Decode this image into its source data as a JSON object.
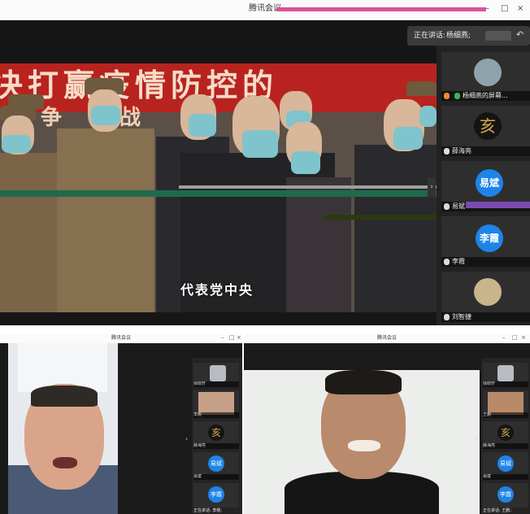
{
  "main_window": {
    "title": "腾讯会议",
    "controls": {
      "minimize": "–",
      "maximize": "□",
      "close": "×"
    },
    "speaking_label": "正在讲话:",
    "speaking_name": "杨细燕;",
    "back_icon": "back-arrow-icon",
    "shared_banner_top": "决打赢疫情防控的",
    "shared_banner_bottom": "争 体战",
    "shared_subtitle": "代表党中央",
    "participants": [
      {
        "name": "杨细燕的屏幕...",
        "avatar": "",
        "type": "image"
      },
      {
        "name": "薛海亮",
        "avatar": "亥",
        "type": "char"
      },
      {
        "name": "易斌",
        "avatar": "易斌",
        "type": "circle"
      },
      {
        "name": "李霞",
        "avatar": "李霞",
        "type": "circle"
      },
      {
        "name": "刘智捷",
        "avatar": "",
        "type": "image"
      }
    ]
  },
  "bottom_left_window": {
    "title": "腾讯会议",
    "speaking_label": "正在讲话: 李桃;",
    "participants": [
      {
        "name": "徐晓轩",
        "avatar": "",
        "type": "image"
      },
      {
        "name": "李桃",
        "avatar": "",
        "type": "image"
      },
      {
        "name": "薛海亮",
        "avatar": "亥",
        "type": "char"
      },
      {
        "name": "易斌",
        "avatar": "易斌",
        "type": "circle"
      },
      {
        "name": "",
        "avatar": "李霞",
        "type": "circle"
      }
    ]
  },
  "bottom_right_window": {
    "title": "腾讯会议",
    "speaking_label": "正在讲话: 王鹏;",
    "participants": [
      {
        "name": "徐晓轩",
        "avatar": "",
        "type": "image"
      },
      {
        "name": "王鹏",
        "avatar": "",
        "type": "image"
      },
      {
        "name": "薛海亮",
        "avatar": "亥",
        "type": "char"
      },
      {
        "name": "易斌",
        "avatar": "易斌",
        "type": "circle"
      },
      {
        "name": "",
        "avatar": "李霞",
        "type": "circle"
      }
    ]
  },
  "colors": {
    "accent_blue": "#1e84e8",
    "panel_dark": "#222222",
    "banner_red": "#b8231f",
    "mask_blue": "#7fc4cc"
  }
}
